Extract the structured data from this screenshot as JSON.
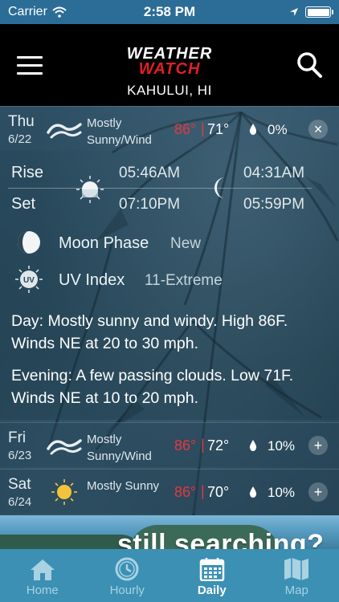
{
  "status_bar": {
    "carrier": "Carrier",
    "time": "2:58 PM"
  },
  "header": {
    "logo_line1": "WEATHER",
    "logo_line2": "WATCH",
    "location": "KAHULUI, HI"
  },
  "days": [
    {
      "name": "Thu",
      "date": "6/22",
      "condition": "Mostly Sunny/Wind",
      "icon": "wind-icon",
      "high": "86°",
      "low": "71°",
      "precip": "0%",
      "toggle": "×",
      "expanded": true
    },
    {
      "name": "Fri",
      "date": "6/23",
      "condition": "Mostly Sunny/Wind",
      "icon": "wind-icon",
      "high": "86°",
      "low": "72°",
      "precip": "10%",
      "toggle": "+",
      "expanded": false
    },
    {
      "name": "Sat",
      "date": "6/24",
      "condition": "Mostly Sunny",
      "icon": "sun-icon",
      "high": "86°",
      "low": "70°",
      "precip": "10%",
      "toggle": "+",
      "expanded": false
    }
  ],
  "details": {
    "rise_label": "Rise",
    "set_label": "Set",
    "sunrise": "05:46AM",
    "sunset": "07:10PM",
    "moonrise": "04:31AM",
    "moonset": "05:59PM",
    "moon_phase_label": "Moon Phase",
    "moon_phase_value": "New",
    "uv_label": "UV Index",
    "uv_value": "11-Extreme",
    "uv_badge": "UV",
    "day_forecast": "Day: Mostly sunny and windy. High 86F. Winds NE at 20 to 30 mph.",
    "evening_forecast": "Evening: A few passing clouds. Low 71F. Winds NE at 10 to 20 mph."
  },
  "ad": {
    "text": "still searching?"
  },
  "tabs": [
    {
      "label": "Home",
      "icon": "home-icon",
      "active": false
    },
    {
      "label": "Hourly",
      "icon": "clock-icon",
      "active": false
    },
    {
      "label": "Daily",
      "icon": "calendar-icon",
      "active": true
    },
    {
      "label": "Map",
      "icon": "map-icon",
      "active": false
    }
  ],
  "colors": {
    "status_bar": "#2b6d97",
    "header": "#000000",
    "temp_high": "#e4383f",
    "tab_bar": "#3b90b4"
  }
}
